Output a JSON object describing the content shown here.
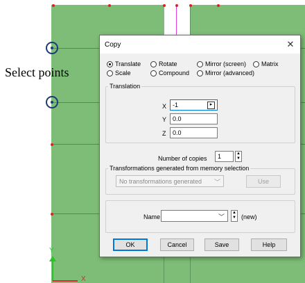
{
  "annotation": {
    "text": "Select points"
  },
  "canvas": {
    "axis_x_label": "X",
    "axis_y_label": "Y",
    "background_color": "#7dbd77"
  },
  "dialog": {
    "title": "Copy",
    "close_label": "✕",
    "modes": {
      "translate": "Translate",
      "rotate": "Rotate",
      "mirror_screen": "Mirror (screen)",
      "matrix": "Matrix",
      "scale": "Scale",
      "compound": "Compound",
      "mirror_advanced": "Mirror (advanced)",
      "selected": "Translate"
    },
    "translation": {
      "group_label": "Translation",
      "x_label": "X",
      "x_value": "-1",
      "y_label": "Y",
      "y_value": "0.0",
      "z_label": "Z",
      "z_value": "0.0"
    },
    "copies": {
      "label": "Number of copies",
      "value": "1"
    },
    "memory": {
      "group_label": "Transformations generated from memory selection",
      "select_value": "No transformations generated",
      "use_label": "Use"
    },
    "name": {
      "label": "Name",
      "value": "",
      "suffix": "(new)"
    },
    "buttons": {
      "ok": "OK",
      "cancel": "Cancel",
      "save": "Save",
      "help": "Help"
    }
  }
}
